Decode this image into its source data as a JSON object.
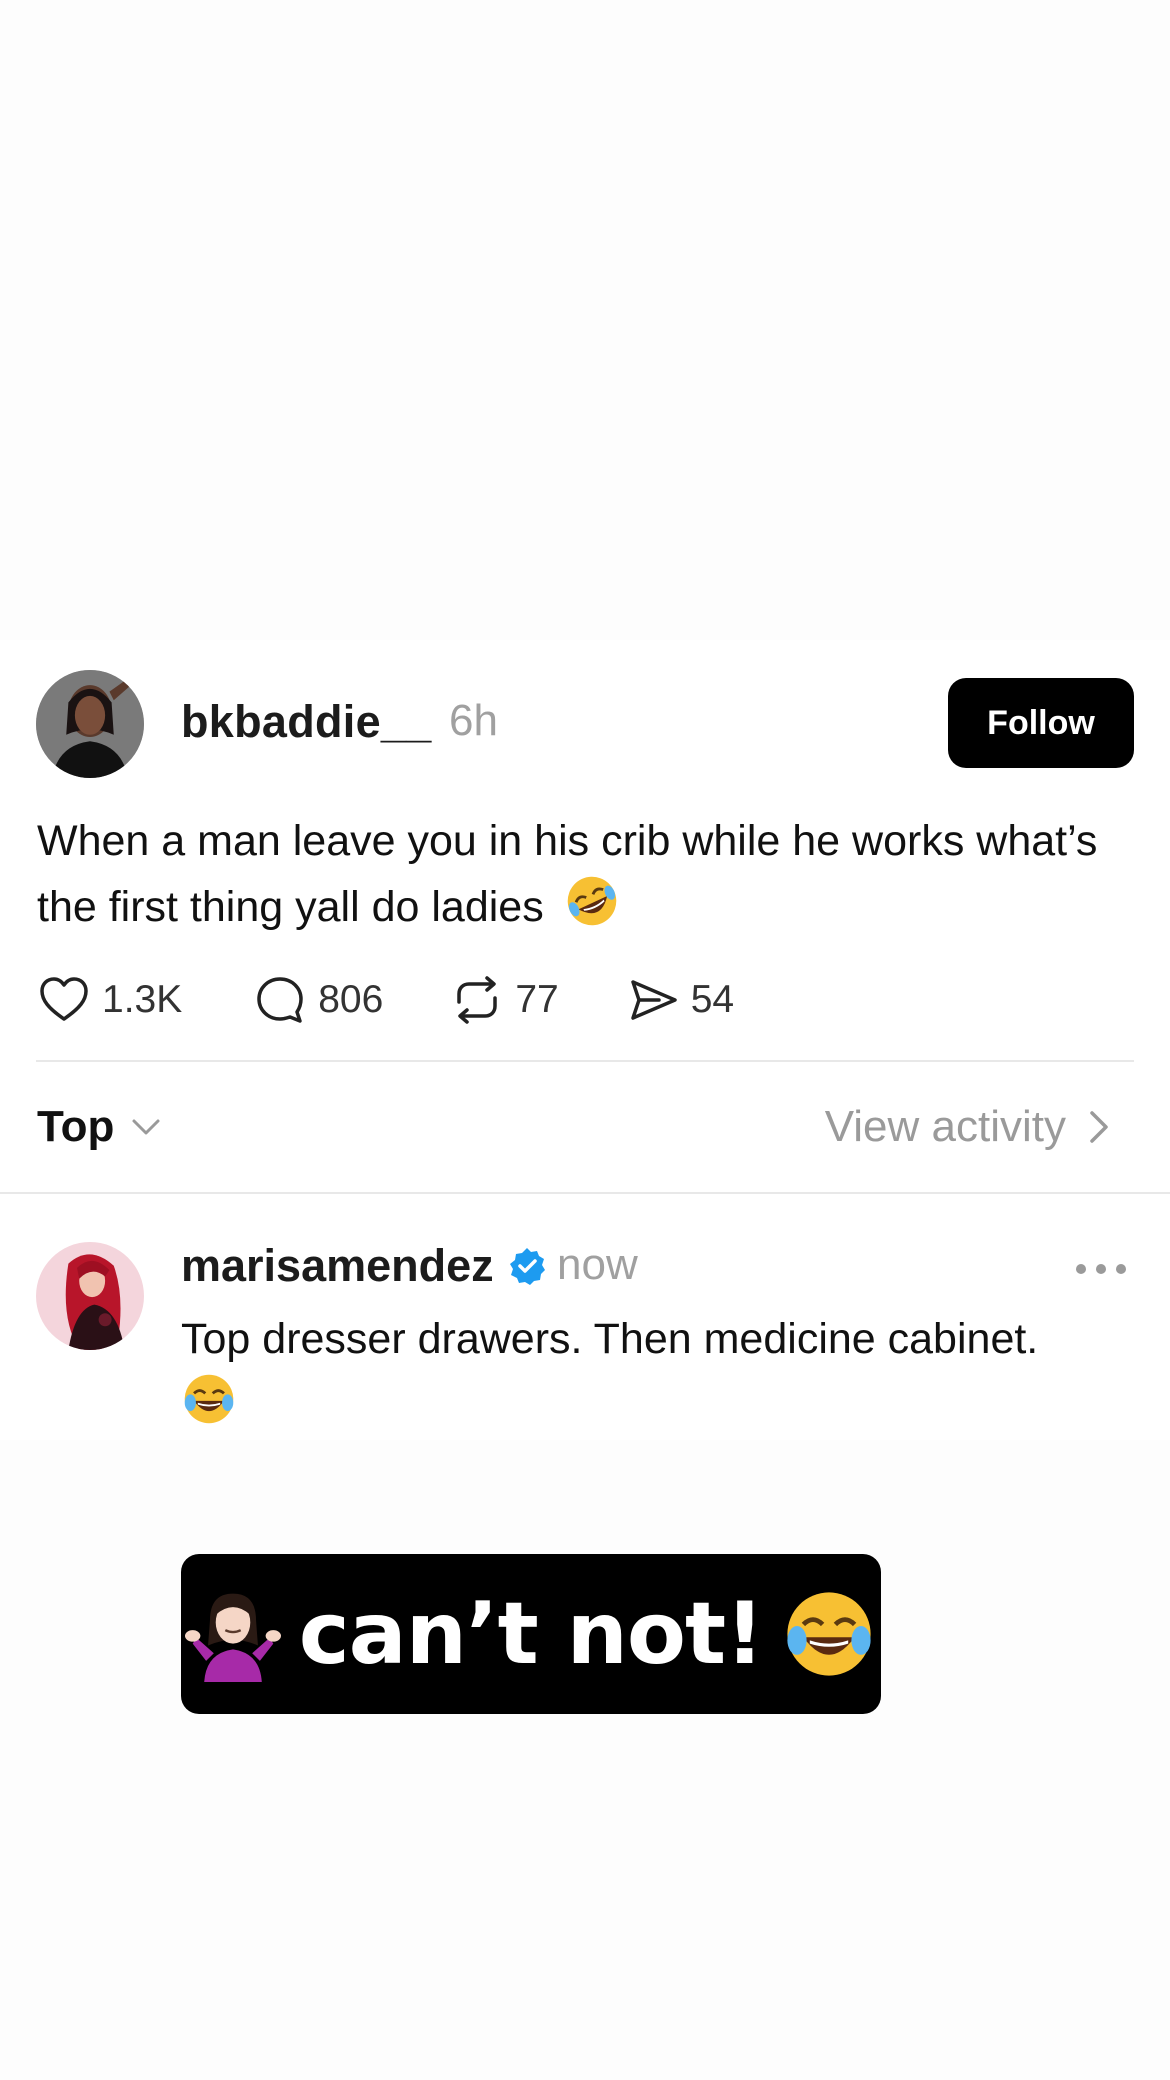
{
  "post": {
    "username": "bkbaddie__",
    "time": "6h",
    "follow_label": "Follow",
    "text": "When a man leave you in his crib while he works what’s the first thing yall do ladies",
    "text_emoji": "rolling-on-floor-laughing-emoji",
    "stats": {
      "likes": "1.3K",
      "replies": "806",
      "reposts": "77",
      "shares": "54"
    }
  },
  "thread_controls": {
    "sort_label": "Top",
    "view_activity_label": "View activity"
  },
  "reply": {
    "username": "marisamendez",
    "verified": true,
    "time": "now",
    "text": "Top dresser drawers. Then medicine cabinet.",
    "text_emoji": "face-with-tears-of-joy-emoji"
  },
  "sticker": {
    "text": "can’t not!",
    "left_emoji": "person-shrugging-emoji",
    "right_emoji": "face-with-tears-of-joy-emoji"
  },
  "colors": {
    "follow_bg": "#000000",
    "verified_blue": "#1d9bf0",
    "muted_text": "#a0a0a0"
  }
}
